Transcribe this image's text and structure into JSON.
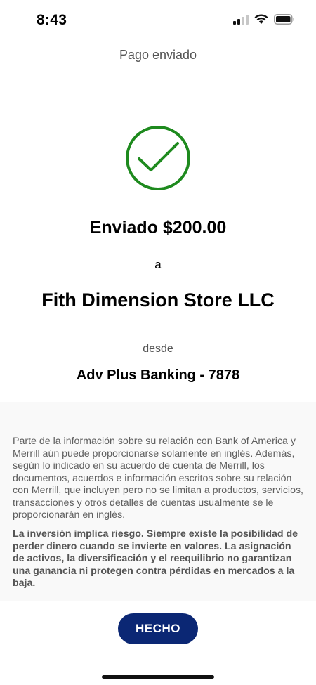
{
  "status_bar": {
    "time": "8:43",
    "icons": [
      "cellular-signal-icon",
      "wifi-icon",
      "battery-icon"
    ]
  },
  "header": {
    "title": "Pago enviado"
  },
  "confirmation": {
    "icon": "checkmark-circle-icon",
    "icon_color": "#1e8a1e",
    "sent_amount": "Enviado $200.00",
    "to_label": "a",
    "payee": "Fith Dimension Store LLC",
    "from_label": "desde",
    "account": "Adv Plus Banking - 7878"
  },
  "disclosure": {
    "text": "Parte de la información sobre su relación con Bank of America y Merrill aún puede proporcionarse solamente en inglés. Además, según lo indicado en su acuerdo de cuenta de Merrill, los documentos, acuerdos e información escritos sobre su relación con Merrill, que incluyen pero no se limitan a productos, servicios, transacciones y otros detalles de cuentas usualmente se le proporcionarán en inglés.",
    "risk_text": "La inversión implica riesgo. Siempre existe la posibilidad de perder dinero cuando se invierte en valores. La asignación de activos, la diversificación y el reequilibrio no garantizan una ganancia ni protegen contra pérdidas en mercados a la baja."
  },
  "actions": {
    "done_label": "HECHO",
    "done_color": "#0b2774"
  }
}
